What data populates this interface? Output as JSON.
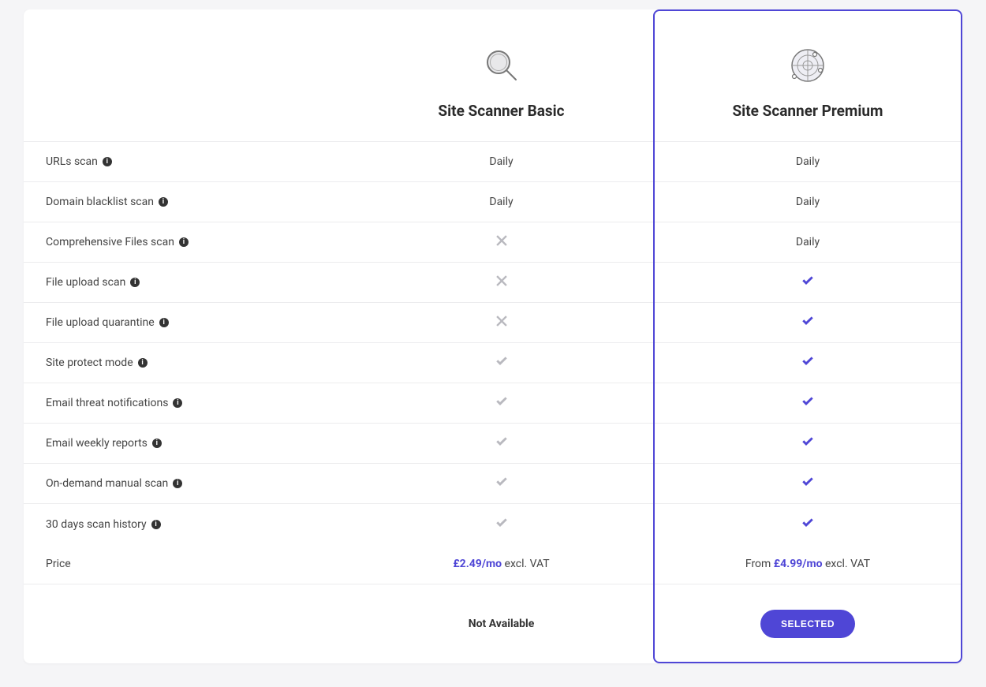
{
  "plans": {
    "basic": {
      "title": "Site Scanner Basic"
    },
    "premium": {
      "title": "Site Scanner Premium"
    }
  },
  "features": [
    {
      "label": "URLs scan",
      "basic": "Daily",
      "premium": "Daily"
    },
    {
      "label": "Domain blacklist scan",
      "basic": "Daily",
      "premium": "Daily"
    },
    {
      "label": "Comprehensive Files scan",
      "basic": "x",
      "premium": "Daily"
    },
    {
      "label": "File upload scan",
      "basic": "x",
      "premium": "check"
    },
    {
      "label": "File upload quarantine",
      "basic": "x",
      "premium": "check"
    },
    {
      "label": "Site protect mode",
      "basic": "check",
      "premium": "check"
    },
    {
      "label": "Email threat notifications",
      "basic": "check",
      "premium": "check"
    },
    {
      "label": "Email weekly reports",
      "basic": "check",
      "premium": "check"
    },
    {
      "label": "On-demand manual scan",
      "basic": "check",
      "premium": "check"
    },
    {
      "label": "30 days scan history",
      "basic": "check",
      "premium": "check"
    }
  ],
  "price_row": {
    "label": "Price",
    "basic": {
      "prefix": "",
      "price": "£2.49/mo",
      "suffix": " excl. VAT"
    },
    "premium": {
      "prefix": "From ",
      "price": "£4.99/mo",
      "suffix": " excl. VAT"
    }
  },
  "action_row": {
    "basic_text": "Not Available",
    "premium_button": "SELECTED"
  }
}
